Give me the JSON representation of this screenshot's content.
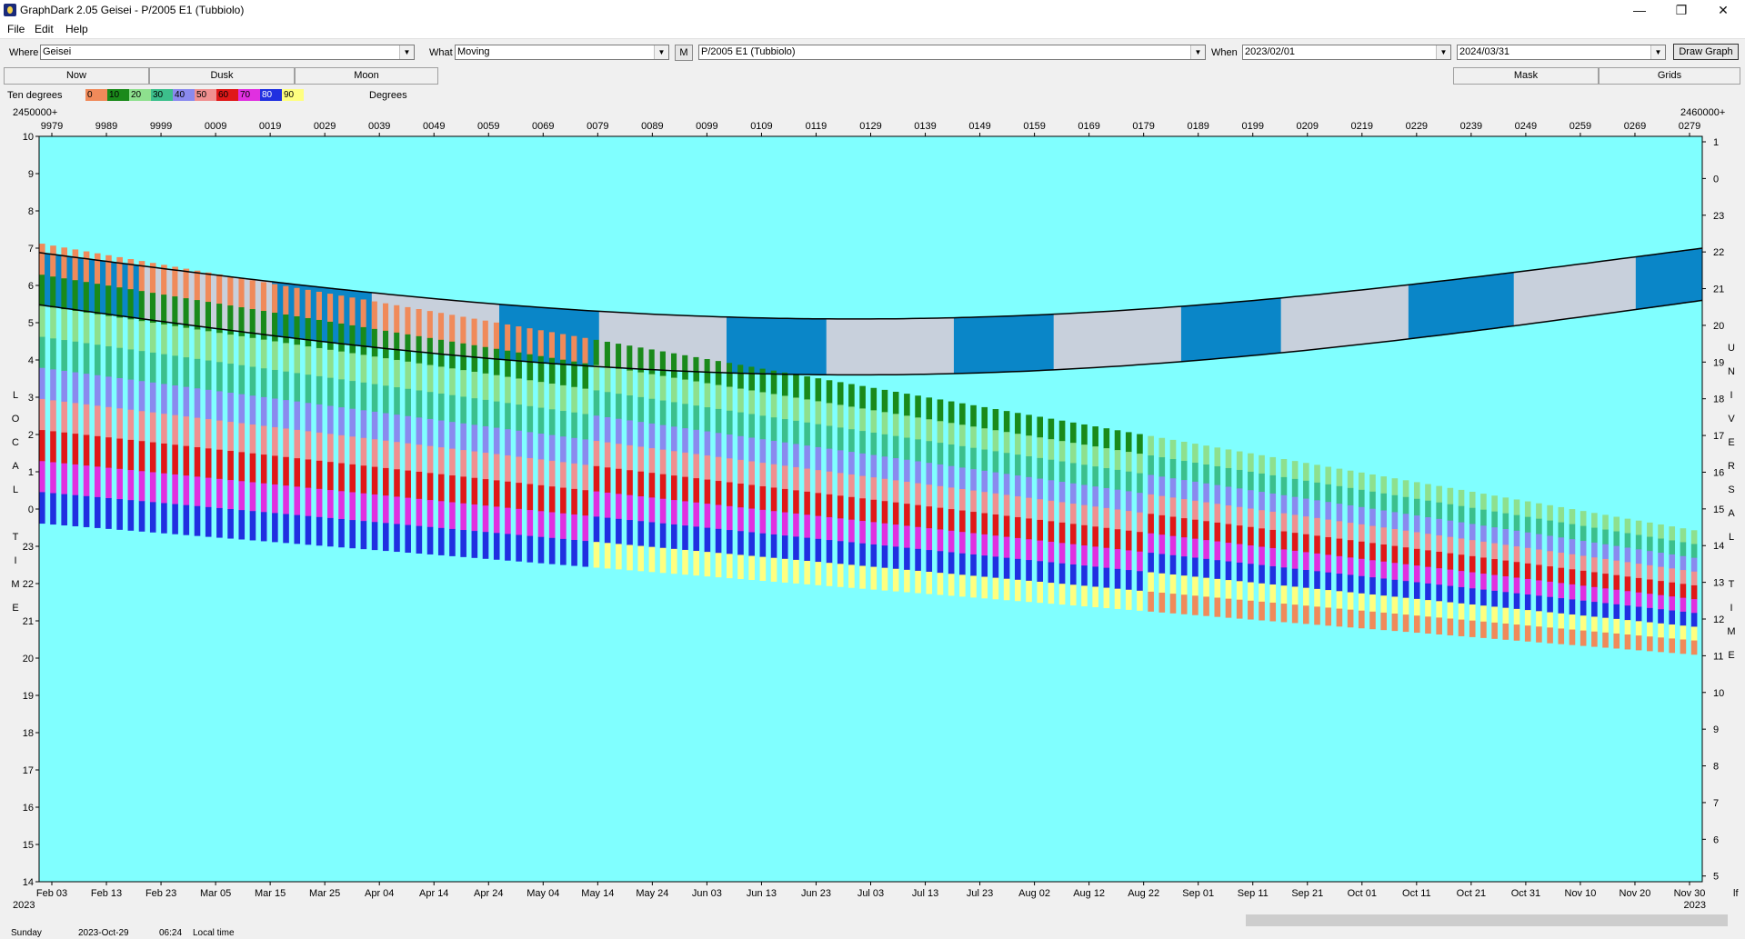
{
  "window": {
    "title": "GraphDark 2.05  Geisei  -  P/2005 E1 (Tubbiolo)"
  },
  "menu": [
    "File",
    "Edit",
    "Help"
  ],
  "toolbar": {
    "where_label": "Where",
    "where_value": "Geisei",
    "what_label": "What",
    "what_value": "Moving",
    "m_label": "M",
    "object_value": "P/2005 E1 (Tubbiolo)",
    "when_label": "When",
    "when_from": "2023/02/01",
    "when_to": "2024/03/31",
    "draw_label": "Draw Graph"
  },
  "tabs": {
    "now": "Now",
    "dusk": "Dusk",
    "moon": "Moon",
    "mask": "Mask",
    "grids": "Grids"
  },
  "legend": {
    "prefix": "Ten degrees",
    "suffix": "Degrees",
    "items": [
      {
        "label": "0",
        "color": "#f08a5a"
      },
      {
        "label": "10",
        "color": "#1a8a1a"
      },
      {
        "label": "20",
        "color": "#8ee08e"
      },
      {
        "label": "30",
        "color": "#3cbf8c"
      },
      {
        "label": "40",
        "color": "#8a8aee"
      },
      {
        "label": "50",
        "color": "#f09090"
      },
      {
        "label": "60",
        "color": "#e01818"
      },
      {
        "label": "70",
        "color": "#e030e0"
      },
      {
        "label": "80",
        "color": "#2030e0"
      },
      {
        "label": "90",
        "color": "#ffff80"
      }
    ]
  },
  "jd": {
    "left": "2450000+",
    "right": "2460000+"
  },
  "top_ticks": [
    "9979",
    "9989",
    "9999",
    "0009",
    "0019",
    "0029",
    "0039",
    "0049",
    "0059",
    "0069",
    "0079",
    "0089",
    "0099",
    "0109",
    "0119",
    "0129",
    "0139",
    "0149",
    "0159",
    "0169",
    "0179",
    "0189",
    "0199",
    "0209",
    "0219",
    "0229",
    "0239",
    "0249",
    "0259",
    "0269",
    "0279"
  ],
  "bottom_ticks": [
    "Feb 03",
    "Feb 13",
    "Feb 23",
    "Mar 05",
    "Mar 15",
    "Mar 25",
    "Apr 04",
    "Apr 14",
    "Apr 24",
    "May 04",
    "May 14",
    "May 24",
    "Jun 03",
    "Jun 13",
    "Jun 23",
    "Jul 03",
    "Jul 13",
    "Jul 23",
    "Aug 02",
    "Aug 12",
    "Aug 22",
    "Sep 01",
    "Sep 11",
    "Sep 21",
    "Oct 01",
    "Oct 11",
    "Oct 21",
    "Oct 31",
    "Nov 10",
    "Nov 20",
    "Nov 30"
  ],
  "year_left": "2023",
  "year_right": "2023",
  "bottom_right_cut": "lf",
  "left_ticks": [
    "10",
    "9",
    "8",
    "7",
    "6",
    "5",
    "4",
    "3",
    "2",
    "1",
    "0",
    "23",
    "22",
    "21",
    "20",
    "19",
    "18",
    "17",
    "16",
    "15",
    "14"
  ],
  "right_ticks": [
    "1",
    "0",
    "23",
    "22",
    "21",
    "20",
    "19",
    "18",
    "17",
    "16",
    "15",
    "14",
    "13",
    "12",
    "11",
    "10",
    "9",
    "8",
    "7",
    "6",
    "5"
  ],
  "left_axis_letters": [
    "L",
    "O",
    "C",
    "A",
    "L",
    "",
    "T",
    "I",
    "M",
    "E"
  ],
  "right_axis_letters": [
    "U",
    "N",
    "I",
    "V",
    "E",
    "R",
    "S",
    "A",
    "L",
    "",
    "T",
    "I",
    "M",
    "E"
  ],
  "status": {
    "day": "Sunday",
    "date": "2023-Oct-29",
    "time": "06:24",
    "label": "Local time"
  },
  "colors": {
    "daylight": "#80ffff",
    "night": "#0a0840",
    "moonlit": "#c8d0dc",
    "twilight": "#0a86c8"
  }
}
